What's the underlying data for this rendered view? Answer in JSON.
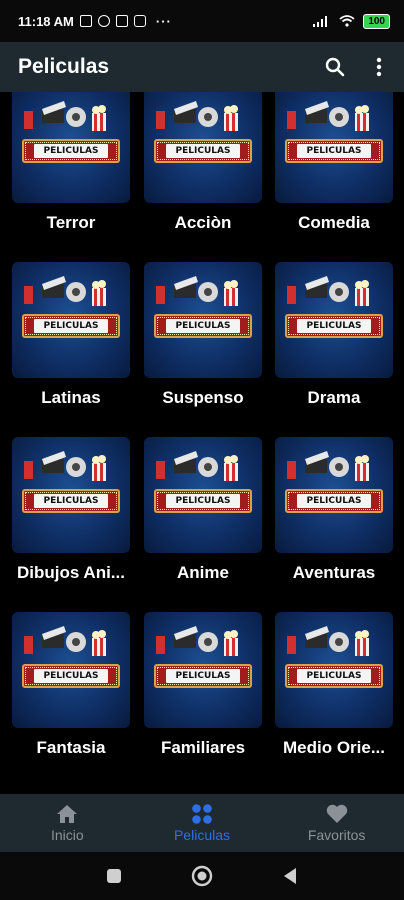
{
  "status_bar": {
    "time": "11:18 AM",
    "dots": "···",
    "battery": "100"
  },
  "app_bar": {
    "title": "Peliculas",
    "search_icon": "search-icon",
    "menu_icon": "more-vert-icon"
  },
  "grid": {
    "thumbnail_label": "PELICULAS",
    "items": [
      {
        "label": "Terror"
      },
      {
        "label": "Acciòn"
      },
      {
        "label": "Comedia"
      },
      {
        "label": "Latinas"
      },
      {
        "label": "Suspenso"
      },
      {
        "label": "Drama"
      },
      {
        "label": "Dibujos Ani..."
      },
      {
        "label": "Anime"
      },
      {
        "label": "Aventuras"
      },
      {
        "label": "Fantasia"
      },
      {
        "label": "Familiares"
      },
      {
        "label": "Medio Orie..."
      }
    ]
  },
  "bottom_nav": {
    "items": [
      {
        "label": "Inicio",
        "icon": "home-icon"
      },
      {
        "label": "Peliculas",
        "icon": "grid-icon",
        "active": true
      },
      {
        "label": "Favoritos",
        "icon": "heart-icon"
      }
    ],
    "active_color": "#2f6fe6",
    "inactive_color": "#8b9196"
  },
  "system_nav": {
    "buttons": [
      "recents-icon",
      "home-circle-icon",
      "back-icon"
    ]
  }
}
